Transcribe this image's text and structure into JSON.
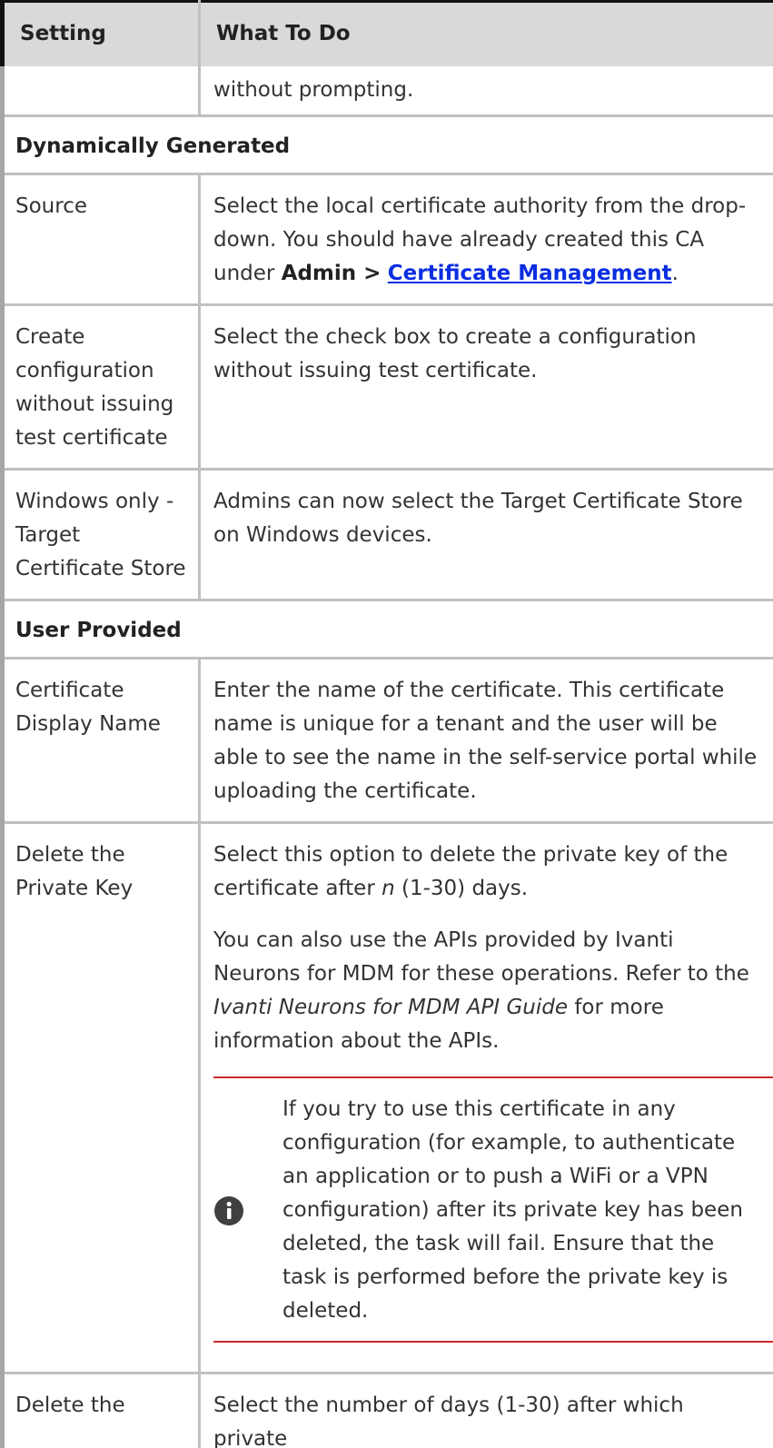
{
  "header": {
    "col1": "Setting",
    "col2": "What To Do"
  },
  "first_row": {
    "col2": "without prompting."
  },
  "sections": {
    "dynamic": "Dynamically Generated",
    "user": "User Provided"
  },
  "rows": {
    "source": {
      "setting": "Source",
      "desc_pre": "Select the local certificate authority from the drop-down. You should have already created this CA under ",
      "admin": "Admin >",
      "link": "Certificate Management",
      "desc_post": "."
    },
    "create_config": {
      "setting": "Create configuration without issuing test certificate",
      "desc": "Select the check box to create a configuration without issuing test certificate."
    },
    "windows_only": {
      "setting": "Windows only - Target Certificate Store",
      "desc": "Admins can now select the Target Certificate Store on Windows devices."
    },
    "display_name": {
      "setting": "Certificate Display Name",
      "desc": "Enter the name of the certificate. This certificate name is unique for a tenant and the user will be able to see the name in the self-service portal while uploading the certificate."
    },
    "delete_key": {
      "setting": "Delete the Private Key",
      "p1_pre": "Select this option to delete the private key of the certificate after ",
      "p1_n": "n",
      "p1_post": " (1-30) days.",
      "p2_pre": "You can also use the APIs provided by Ivanti Neurons for MDM for these operations. Refer to the ",
      "p2_guide": "Ivanti Neurons for MDM API Guide",
      "p2_post": " for more information about the APIs.",
      "note": "If you try to use this certificate in any configuration (for example, to authenticate an application or to push a WiFi or a VPN configuration) after its private key has been deleted, the task will fail. Ensure that the task is performed before the private key is deleted.",
      "note_icon": "info-icon"
    },
    "delete_days": {
      "setting": "Delete the",
      "desc": "Select the number of days (1-30) after which private"
    }
  }
}
